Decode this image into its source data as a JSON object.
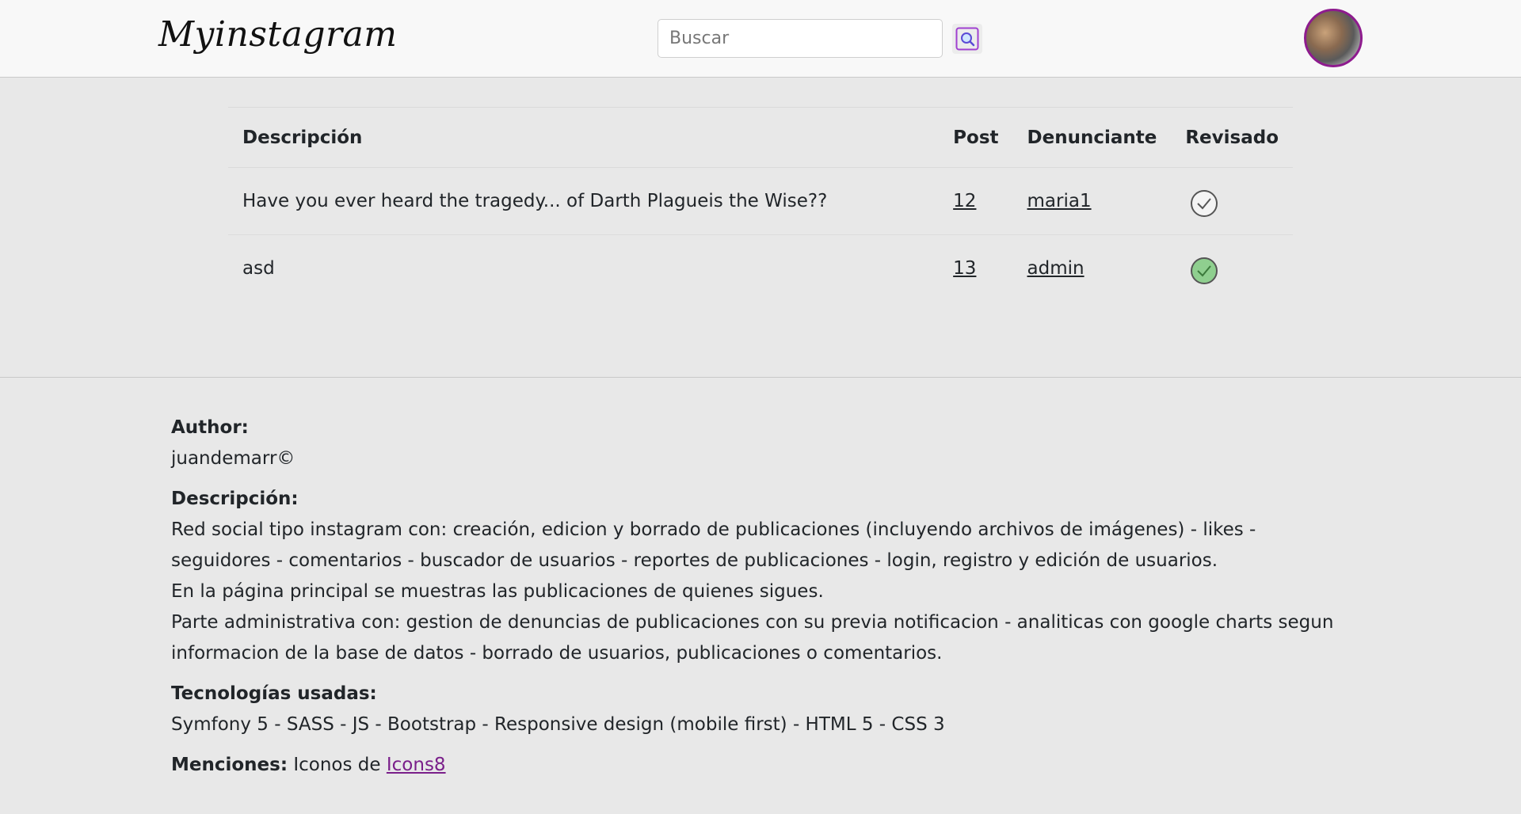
{
  "header": {
    "brand": "Myinstagram",
    "search_placeholder": "Buscar"
  },
  "reports_table": {
    "columns": {
      "description": "Descripción",
      "post": "Post",
      "reporter": "Denunciante",
      "reviewed": "Revisado"
    },
    "rows": [
      {
        "description": "Have you ever heard the tragedy... of Darth Plagueis the Wise??",
        "post": "12",
        "reporter": "maria1",
        "reviewed": false
      },
      {
        "description": "asd",
        "post": "13",
        "reporter": "admin",
        "reviewed": true
      }
    ]
  },
  "footer": {
    "author_label": "Author:",
    "author_value": "juandemarr©",
    "description_label": "Descripción:",
    "description_lines": [
      "Red social tipo instagram con: creación, edicion y borrado de publicaciones (incluyendo archivos de imágenes) - likes - seguidores - comentarios - buscador de usuarios - reportes de publicaciones - login, registro y edición de usuarios.",
      "En la página principal se muestras las publicaciones de quienes sigues.",
      "Parte administrativa con: gestion de denuncias de publicaciones con su previa notificacion - analiticas con google charts segun informacion de la base de datos - borrado de usuarios, publicaciones o comentarios."
    ],
    "tech_label": "Tecnologías usadas:",
    "tech_value": "Symfony 5 - SASS - JS - Bootstrap - Responsive design (mobile first) - HTML 5 - CSS 3",
    "mentions_label": "Menciones:",
    "mentions_text": "Iconos de",
    "mentions_link": "Icons8"
  },
  "colors": {
    "brand_purple": "#8e1b8e",
    "reviewed_green": "#8fcf8f",
    "link_purple": "#7a1f8a"
  }
}
